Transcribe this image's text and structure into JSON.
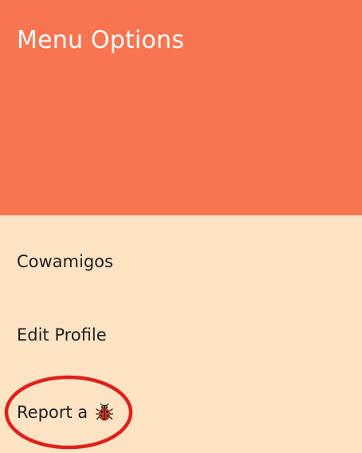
{
  "drawer": {
    "title": "Menu Options",
    "header_color": "#F97551",
    "body_color": "#FEE3C5"
  },
  "menu": {
    "items": [
      {
        "label": "Cowamigos"
      },
      {
        "label": "Edit Profile"
      },
      {
        "label": "Report a",
        "icon": "ladybug-icon"
      }
    ]
  },
  "annotation": {
    "shape": "ellipse",
    "color": "#E0201A",
    "target": "Report a"
  }
}
